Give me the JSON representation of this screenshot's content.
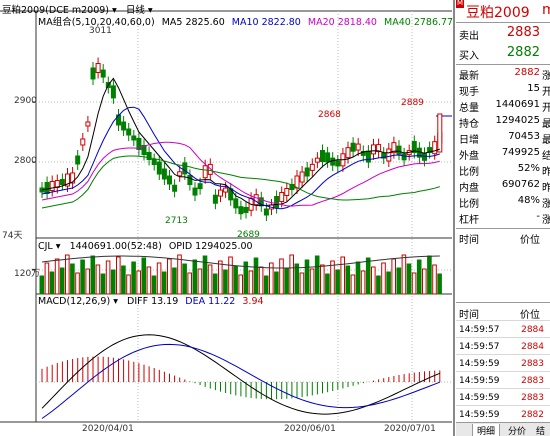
{
  "chart_header": {
    "title": "豆粕2009(DCE m2009)",
    "period": "日线",
    "ma_group": "MA组合(5,10,20,40,60,0)",
    "ma5": "MA5 2825.60",
    "ma10": "MA10 2822.80",
    "ma20": "MA20 2818.40",
    "ma40": "MA40 2786.77"
  },
  "price_axis": [
    "2900",
    "2800"
  ],
  "annotations": {
    "high1": "3011",
    "high2": "2868",
    "last_high": "2889",
    "low1": "2713",
    "low2": "2689",
    "days": "74天"
  },
  "volume_header": {
    "cjl": "CJL",
    "vol": "1440691.00(52:48)",
    "opid": "OPID 1294025.00",
    "axis": "120万"
  },
  "macd_header": {
    "name": "MACD(12,26,9)",
    "diff": "DIFF 13.19",
    "dea": "DEA 11.22",
    "macd": "3.94"
  },
  "date_axis": [
    "2020/04/01",
    "2020/06/01",
    "2020/07/01"
  ],
  "colors": {
    "up": "#d00000",
    "down": "#008000",
    "bg": "#ffffff",
    "ma5": "#000000",
    "ma10": "#0000cc",
    "ma20": "#cc00cc",
    "ma40": "#008000"
  },
  "quote": {
    "symbol": "豆粕2009",
    "symbol_cut": "m",
    "marker": "M",
    "ask_label": "卖出",
    "ask": "2883",
    "bid_label": "买入",
    "bid": "2882",
    "rows": [
      {
        "label": "最新",
        "value": "2882",
        "cut": "涨",
        "red": true
      },
      {
        "label": "现手",
        "value": "15",
        "cut": "开",
        "red": false
      },
      {
        "label": "总量",
        "value": "1440691",
        "cut": "开",
        "red": false
      },
      {
        "label": "持仓",
        "value": "1294025",
        "cut": "最",
        "red": false
      },
      {
        "label": "日增",
        "value": "70453",
        "cut": "最",
        "red": false
      },
      {
        "label": "外盘",
        "value": "749925",
        "cut": "结",
        "red": false
      },
      {
        "label": "比例",
        "value": "52%",
        "cut": "昨",
        "red": false
      },
      {
        "label": "内盘",
        "value": "690762",
        "cut": "昨",
        "red": false
      },
      {
        "label": "比例",
        "value": "48%",
        "cut": "涨",
        "red": false
      },
      {
        "label": "杠杆",
        "value": "-",
        "cut": "涨",
        "red": false
      }
    ]
  },
  "ticks": {
    "time_label": "时间",
    "price_label": "价位",
    "rows": [
      {
        "time": "14:59:57",
        "price": "2884"
      },
      {
        "time": "14:59:57",
        "price": "2884"
      },
      {
        "time": "14:59:59",
        "price": "2883"
      },
      {
        "time": "14:59:59",
        "price": "2883"
      },
      {
        "time": "14:59:59",
        "price": "2883"
      },
      {
        "time": "14:59:59",
        "price": "2882"
      }
    ]
  },
  "bottom_tabs": [
    "明细",
    "分价",
    "结"
  ]
}
